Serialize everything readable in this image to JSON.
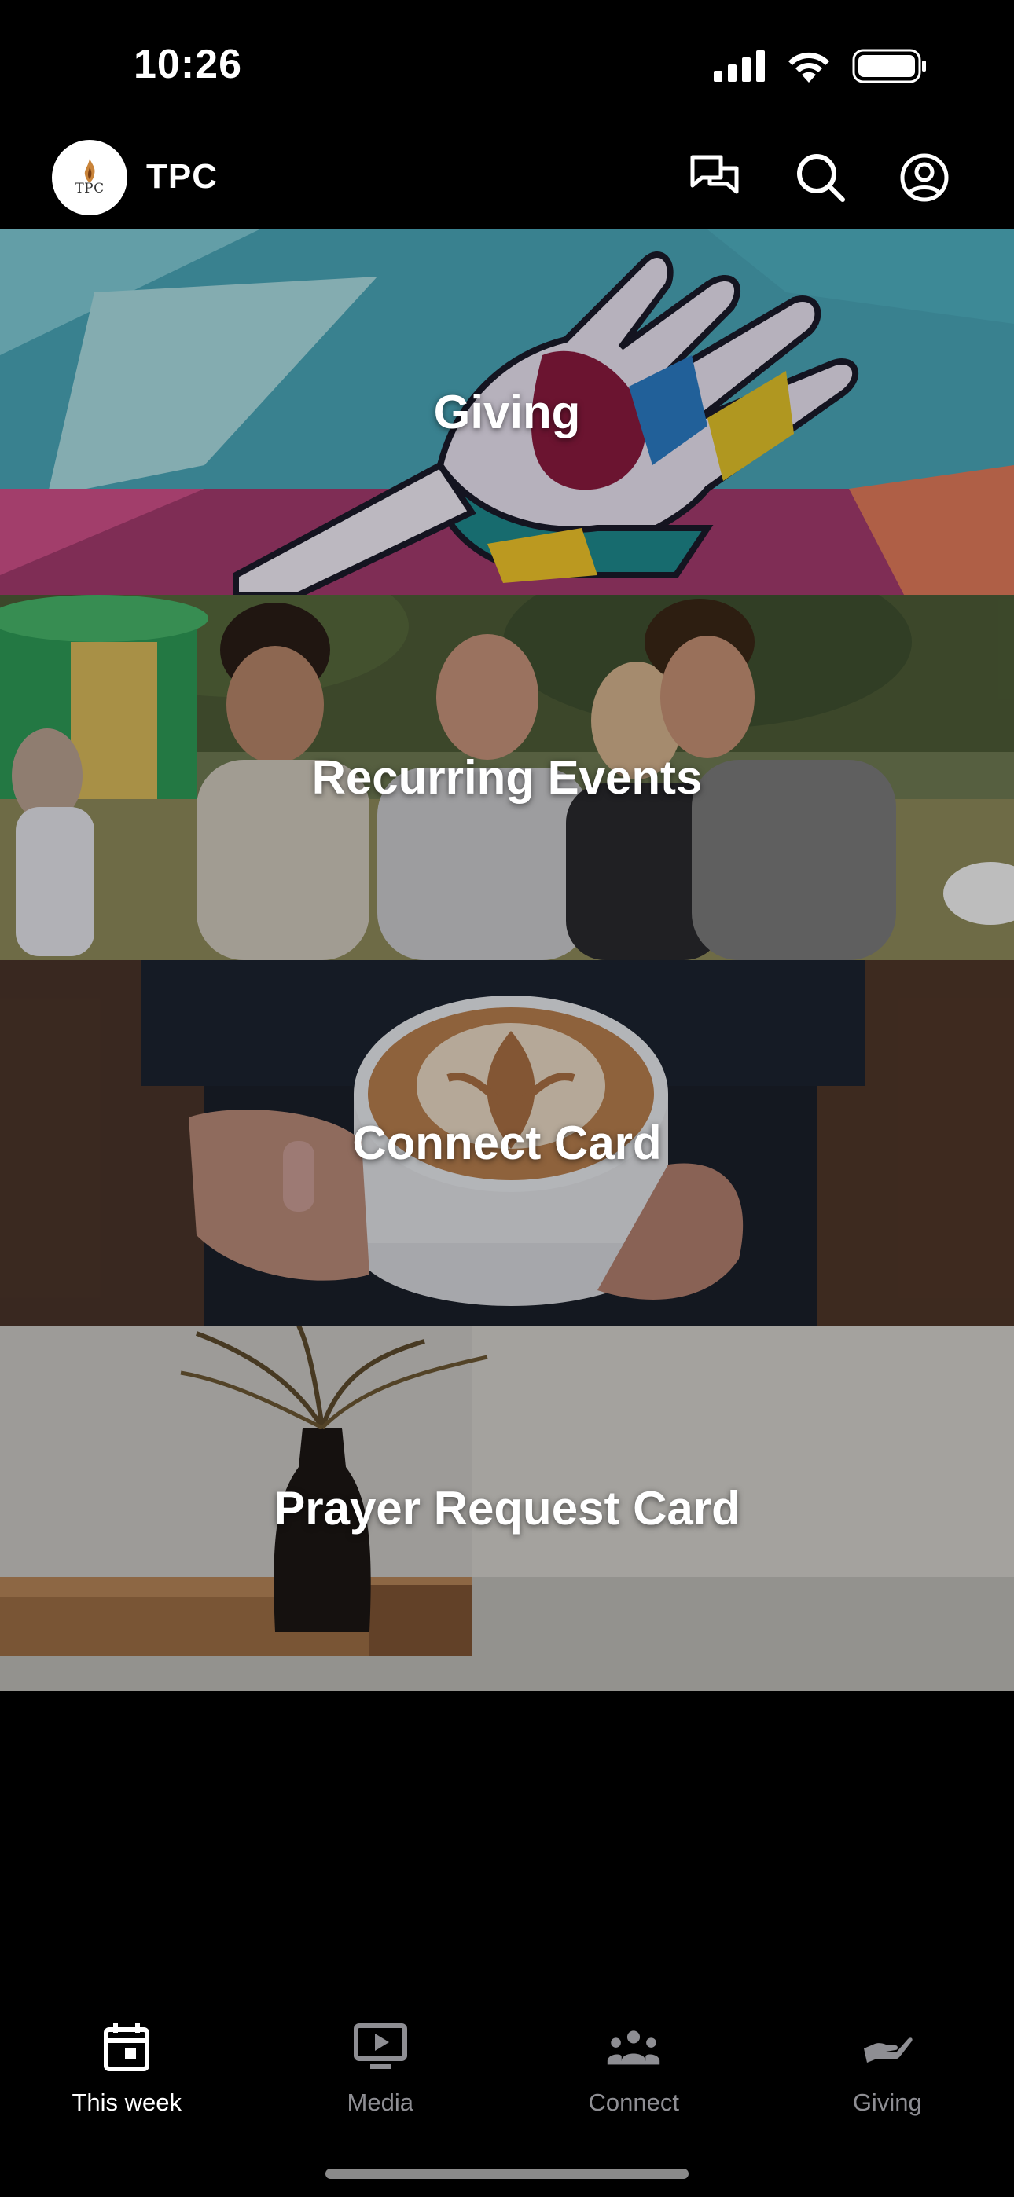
{
  "status_bar": {
    "time": "10:26",
    "icons": [
      "signal-icon",
      "wifi-icon",
      "battery-icon"
    ]
  },
  "header": {
    "logo_text": "TPC",
    "title": "TPC",
    "icons": [
      "chat-icon",
      "search-icon",
      "profile-icon"
    ]
  },
  "tiles": [
    {
      "label": "Giving",
      "image": "mural of painted hands"
    },
    {
      "label": "Recurring Events",
      "image": "group photo outdoors"
    },
    {
      "label": "Connect Card",
      "image": "hands holding latte"
    },
    {
      "label": "Prayer Request Card",
      "image": "vase with dried leaves on wooden shelf"
    }
  ],
  "tabs": [
    {
      "label": "This week",
      "icon": "calendar-icon",
      "active": true
    },
    {
      "label": "Media",
      "icon": "tv-play-icon",
      "active": false
    },
    {
      "label": "Connect",
      "icon": "group-icon",
      "active": false
    },
    {
      "label": "Giving",
      "icon": "giving-hand-icon",
      "active": false
    }
  ],
  "colors": {
    "background": "#000000",
    "active_tab": "#ffffff",
    "inactive_tab": "#8e8e93"
  }
}
